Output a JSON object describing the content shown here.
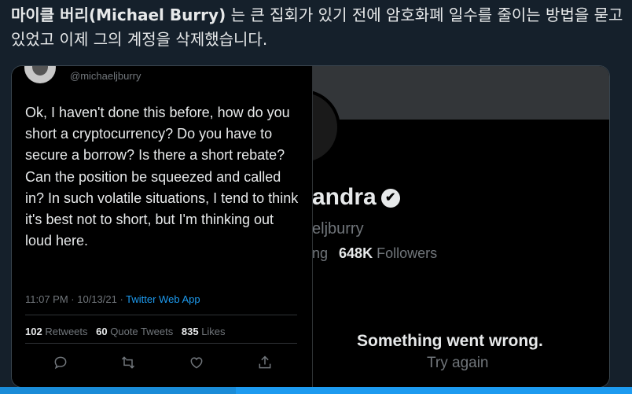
{
  "headline": {
    "name_bold": "마이클 버리(Michael Burry)",
    "rest": " 는 큰 집회가 있기 전에 암호화폐 일수를 줄이는 방법을 묻고 있었고 이제 그의 계정을 삭제했습니다."
  },
  "tweet": {
    "handle": "@michaeljburry",
    "text": "Ok, I haven't done this before, how do you short a cryptocurrency? Do you have to secure a borrow? Is there a short rebate? Can the position be squeezed and called in? In such volatile situations, I tend to think it's best not to short, but I'm thinking out loud here.",
    "timestamp": "11:07 PM · 10/13/21 · ",
    "app": "Twitter Web App",
    "retweets_count": "102",
    "retweets_label": "Retweets",
    "quotes_count": "60",
    "quotes_label": "Quote Tweets",
    "likes_count": "835",
    "likes_label": "Likes"
  },
  "profile": {
    "name_partial": "andra",
    "handle_partial": "eljburry",
    "following_partial": "ng",
    "followers_count": "648K",
    "followers_label": "Followers",
    "error_title": "Something went wrong.",
    "retry_label": "Try again"
  },
  "icons": [
    "reply-icon",
    "retweet-icon",
    "like-icon",
    "share-icon",
    "verified-badge-icon"
  ],
  "colors": {
    "accent": "#1d9bf0",
    "background": "#15202b",
    "muted": "#71767b"
  }
}
